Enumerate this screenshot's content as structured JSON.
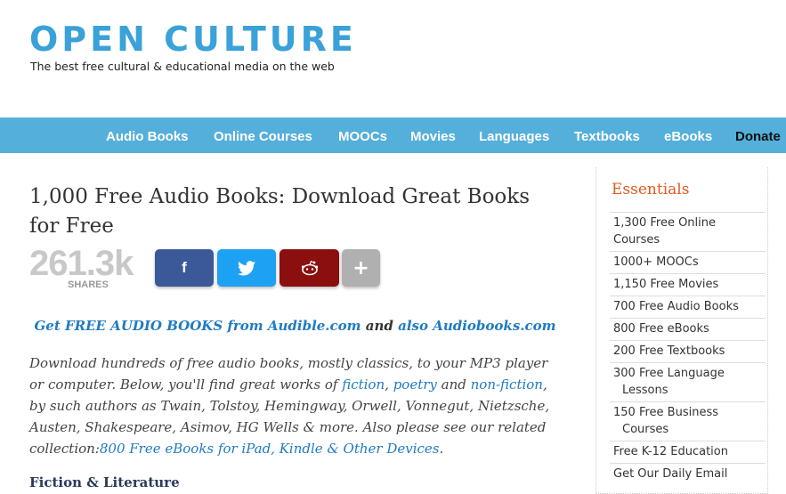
{
  "site": {
    "logo": "OPEN CULTURE",
    "tagline": "The best free cultural & educational media on the web"
  },
  "nav": {
    "items": [
      "Audio Books",
      "Online Courses",
      "MOOCs",
      "Movies",
      "Languages",
      "Textbooks",
      "eBooks",
      "Donate"
    ]
  },
  "article": {
    "title": "1,000 Free Audio Books: Download Great Books for Free",
    "share_count": "261.3k",
    "share_label": "SHARES",
    "share_buttons": [
      "facebook-icon",
      "twitter-icon",
      "reddit-icon",
      "plus-icon"
    ],
    "cta": {
      "link1": "Get FREE AUDIO BOOKS from Audible.com",
      "mid": " and ",
      "link2": "also Audiobooks.com"
    },
    "body": {
      "t1": "Download hundreds of free audio books, mostly classics, to your MP3 player or computer. Below, you'll find great works of ",
      "fiction": "fiction",
      "c1": ", ",
      "poetry": "poetry",
      "and": " and ",
      "nonfiction": "non-fiction",
      "t2": ", by such authors as Twain, Tolstoy, Hemingway, Orwell, Vonnegut, Nietzsche, Austen, Shakespeare, Asimov, HG Wells & more. Also please see our related collection:",
      "link": "800 Free eBooks for iPad, Kindle & Other Devices",
      "end": "."
    },
    "subhead": "Fiction & Literature"
  },
  "sidebar": {
    "title": "Essentials",
    "items": [
      {
        "line1": "1,300 Free Online Courses",
        "line2": ""
      },
      {
        "line1": "1000+ MOOCs",
        "line2": ""
      },
      {
        "line1": "1,150 Free Movies",
        "line2": ""
      },
      {
        "line1": "700 Free Audio Books",
        "line2": ""
      },
      {
        "line1": "800 Free eBooks",
        "line2": ""
      },
      {
        "line1": "200 Free Textbooks",
        "line2": ""
      },
      {
        "line1": "300 Free Language",
        "line2": "Lessons"
      },
      {
        "line1": "150 Free Business",
        "line2": "Courses"
      },
      {
        "line1": "Free K-12 Education",
        "line2": ""
      },
      {
        "line1": "Get Our Daily Email",
        "line2": ""
      }
    ]
  },
  "colors": {
    "brand": "#3aa2d8",
    "nav_bg": "#55afdb",
    "facebook": "#3b5998",
    "twitter": "#1da1f2",
    "reddit": "#8b0f0f",
    "plus": "#b0b0b0",
    "link": "#1f7bc1",
    "sidebar_title": "#e05a1c"
  }
}
